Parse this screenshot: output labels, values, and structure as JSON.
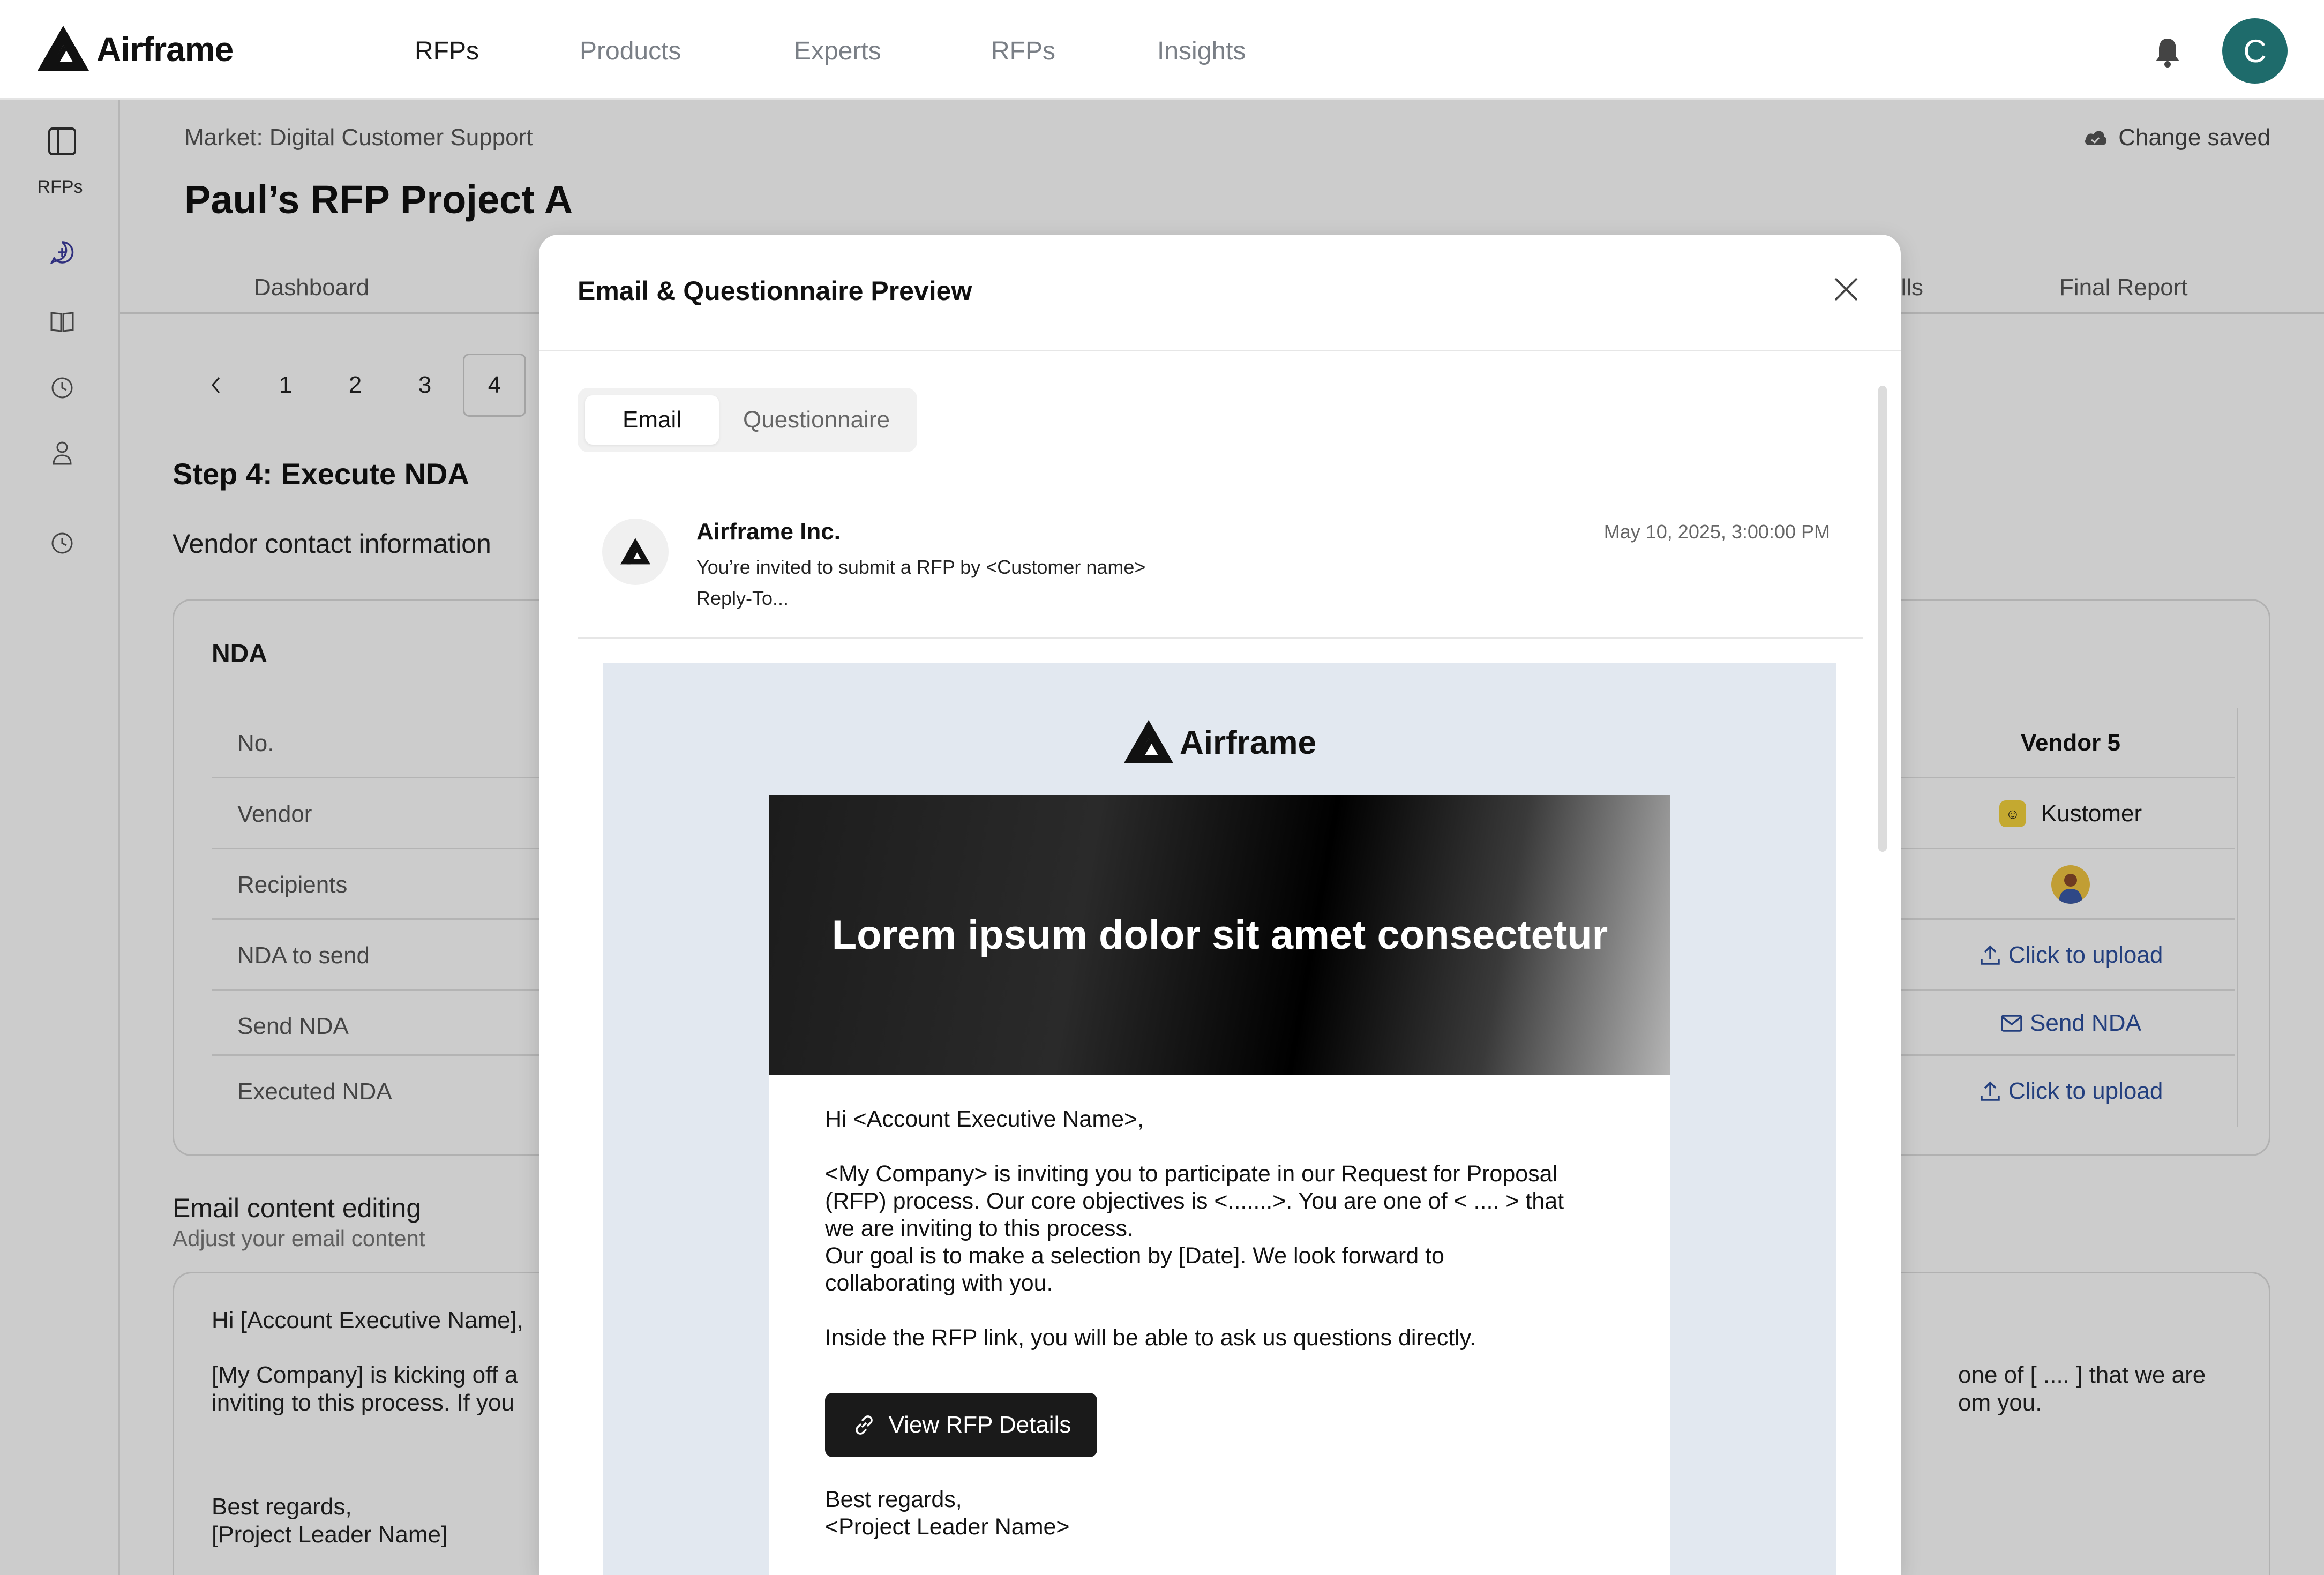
{
  "brand": {
    "name": "Airframe"
  },
  "nav": {
    "items": [
      "RFPs",
      "Products",
      "Experts",
      "RFPs",
      "Insights"
    ],
    "active_index": 0,
    "avatar_initial": "C"
  },
  "rail": {
    "label": "RFPs"
  },
  "page": {
    "breadcrumb": "Market: Digital Customer Support",
    "saved_status": "Change saved",
    "title": "Paul’s RFP Project A",
    "tabs": {
      "first": "Dashboard",
      "partial": "alls",
      "last": "Final Report"
    },
    "pager": [
      "1",
      "2",
      "3",
      "4"
    ],
    "step_title": "Step 4: Execute NDA",
    "section_title": "Vendor contact information"
  },
  "nda": {
    "title": "NDA",
    "rows": [
      "No.",
      "Vendor",
      "Recipients",
      "NDA to send",
      "Send NDA",
      "Executed NDA"
    ],
    "vendor5": {
      "header": "Vendor 5",
      "vendor": "Kustomer",
      "nda_to_send": "Click to upload",
      "send_nda": "Send NDA",
      "executed_nda": "Click to upload"
    }
  },
  "email_edit": {
    "title": "Email content editing",
    "subtitle": "Adjust your email content",
    "greeting": "Hi [Account Executive Name],",
    "line1_left": "[My Company] is kicking off a",
    "line2_left": "inviting to this process.  If you",
    "line1_right": "one of [ .... ] that we are",
    "line2_right": "om you.",
    "signoff": "Best regards,",
    "signature": "[Project Leader Name]"
  },
  "modal": {
    "title": "Email & Questionnaire Preview",
    "tabs": [
      "Email",
      "Questionnaire"
    ],
    "active_tab": 0,
    "sender": {
      "name": "Airframe Inc.",
      "subject": "You’re invited to submit a RFP by <Customer name>",
      "reply_to": "Reply-To...",
      "date": "May 10, 2025, 3:00:00 PM"
    },
    "email": {
      "logo_text": "Airframe",
      "hero": "Lorem ipsum dolor sit amet consectetur",
      "greeting": "Hi <Account Executive Name>,",
      "para1_l1": "<My Company> is inviting you to participate in our Request for Proposal",
      "para1_l2": "(RFP) process.  Our core objectives is <.......>.  You are one of < .... > that",
      "para1_l3": "we are inviting to this process.",
      "para1_l4": "Our goal is to make a selection by [Date].  We look forward to",
      "para1_l5": "collaborating with you.",
      "para2": "Inside the RFP link, you will be able to ask us questions directly.",
      "button": "View RFP Details",
      "signoff": "Best regards,",
      "signature": "<Project Leader Name>"
    }
  },
  "colors": {
    "accent_teal": "#1e6b6b",
    "link_blue": "#2c4f9e",
    "button_dark": "#1a1a1a"
  }
}
